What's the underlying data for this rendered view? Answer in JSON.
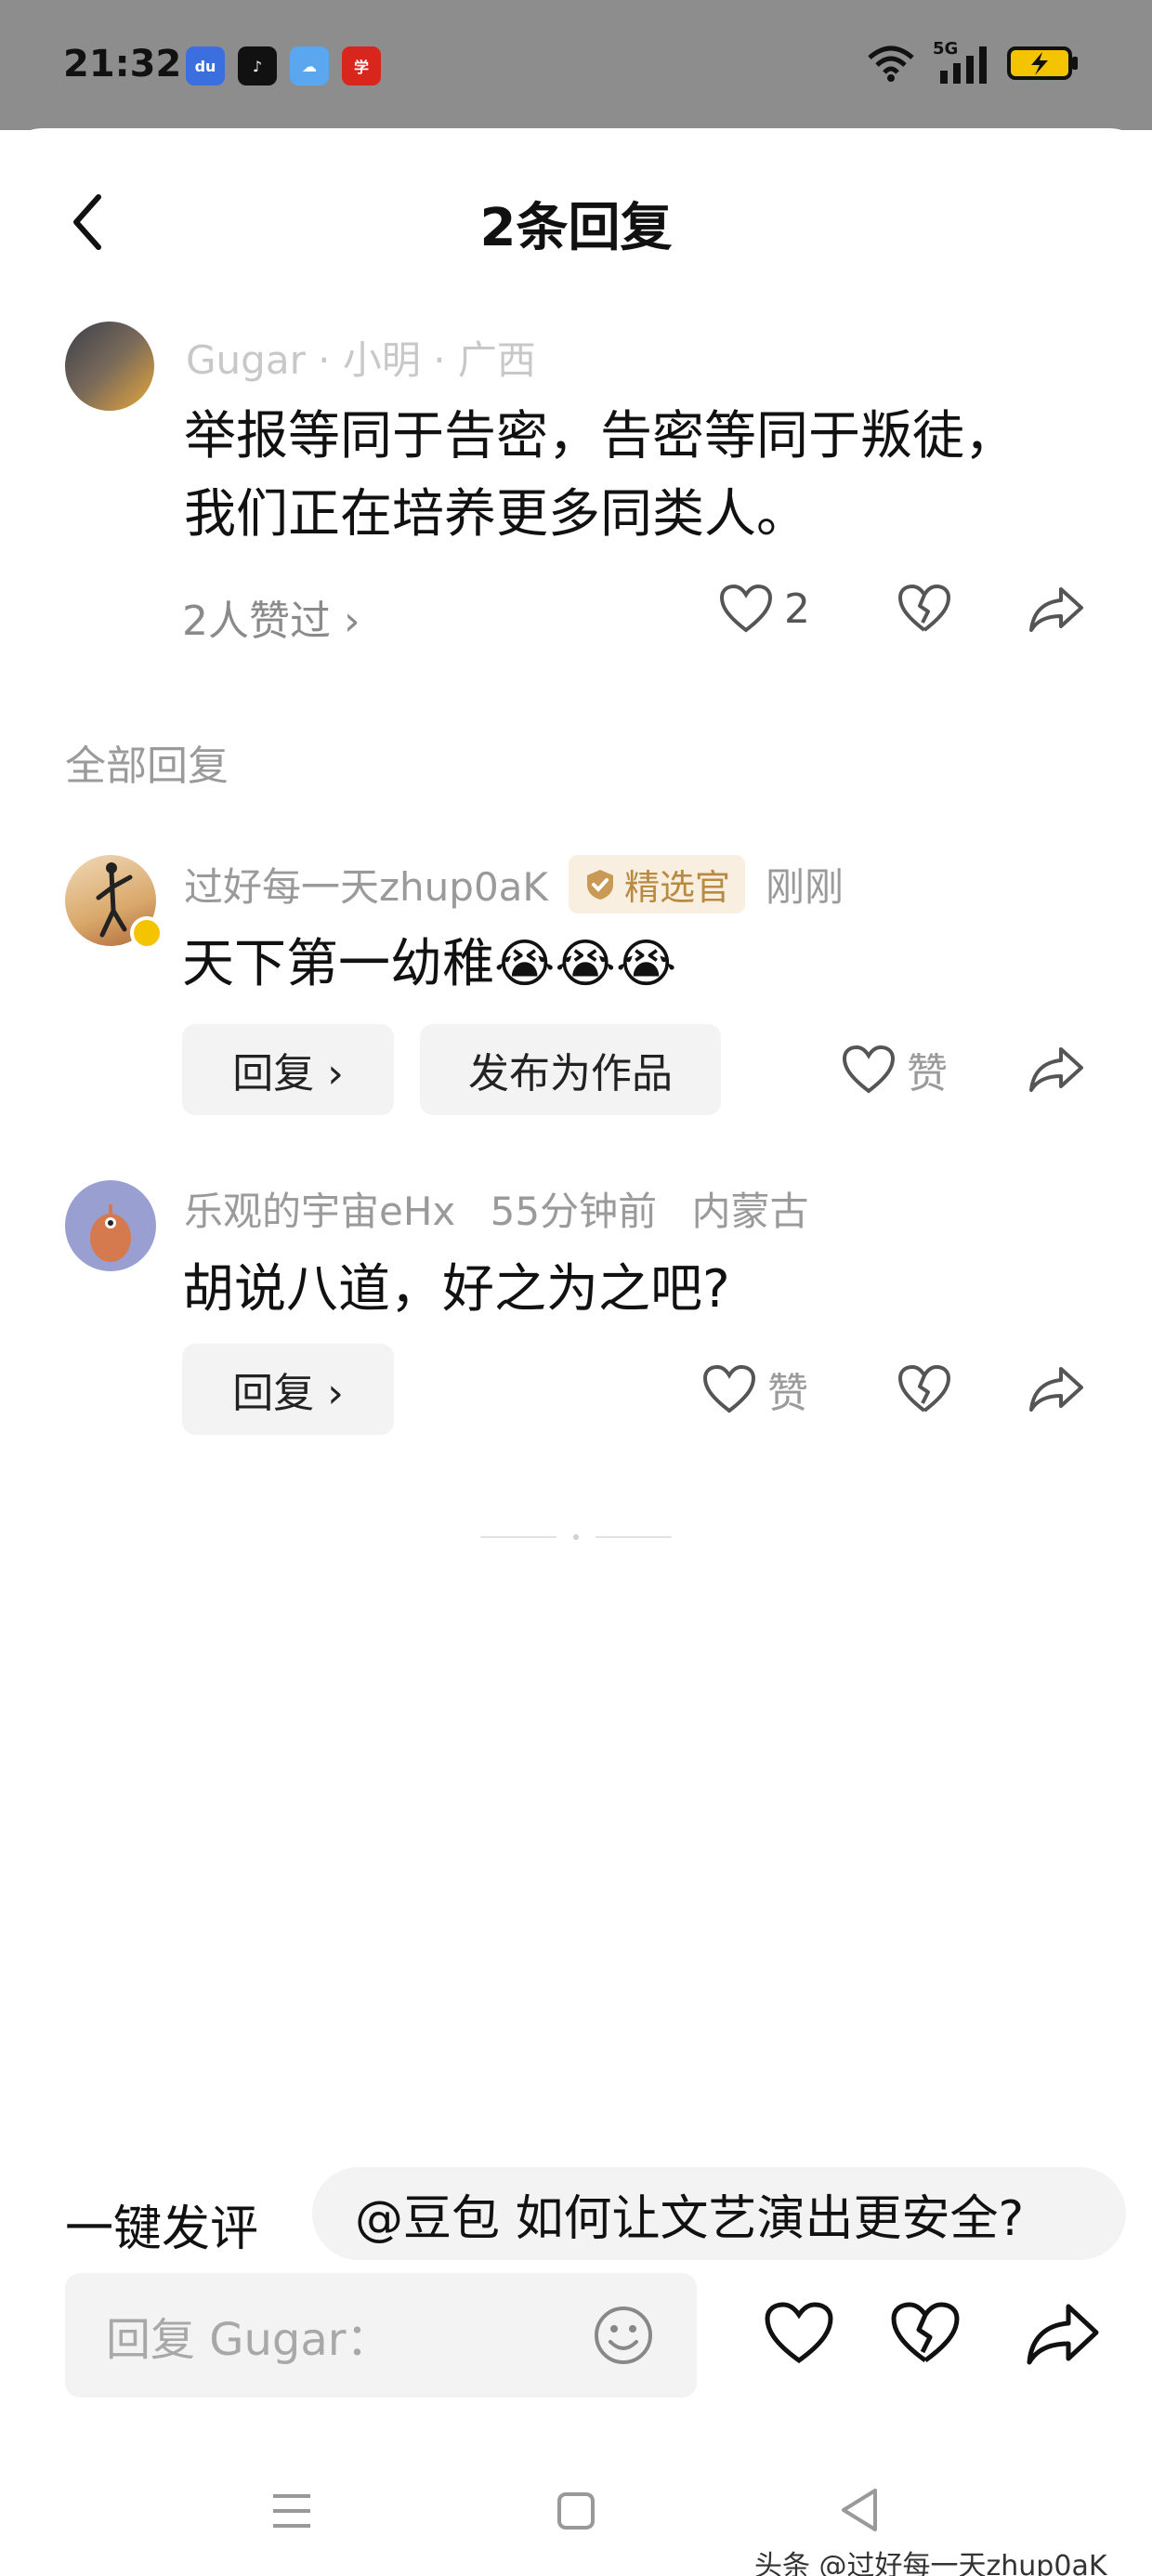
{
  "status": {
    "time": "21:32",
    "network": "5G"
  },
  "header": {
    "title": "2条回复"
  },
  "original_comment": {
    "author": "Gugar · 小明 · 广西",
    "text": "举报等同于告密，告密等同于叛徒，我们正在培养更多同类人。",
    "likes_summary": "2人赞过 ›",
    "like_count": "2"
  },
  "section": {
    "label": "全部回复"
  },
  "replies": [
    {
      "author": "过好每一天zhup0aK",
      "badge": "精选官",
      "time": "刚刚",
      "text": "天下第一幼稚😭😭😭",
      "reply_label": "回复 ›",
      "publish_label": "发布为作品",
      "like_label": "赞"
    },
    {
      "author": "乐观的宇宙eHx",
      "time": "55分钟前",
      "location": "内蒙古",
      "text": "胡说八道，好之为之吧?",
      "reply_label": "回复 ›",
      "like_label": "赞"
    }
  ],
  "quick_comment": {
    "label": "一键发评",
    "suggestion": "@豆包 如何让文艺演出更安全?"
  },
  "composer": {
    "placeholder": "回复 Gugar："
  },
  "watermark": "头条 @过好每一天zhup0aK",
  "colors": {
    "badge_bg": "#f8efe0",
    "badge_text": "#b98a41",
    "gray_text": "#9a9a9a"
  }
}
